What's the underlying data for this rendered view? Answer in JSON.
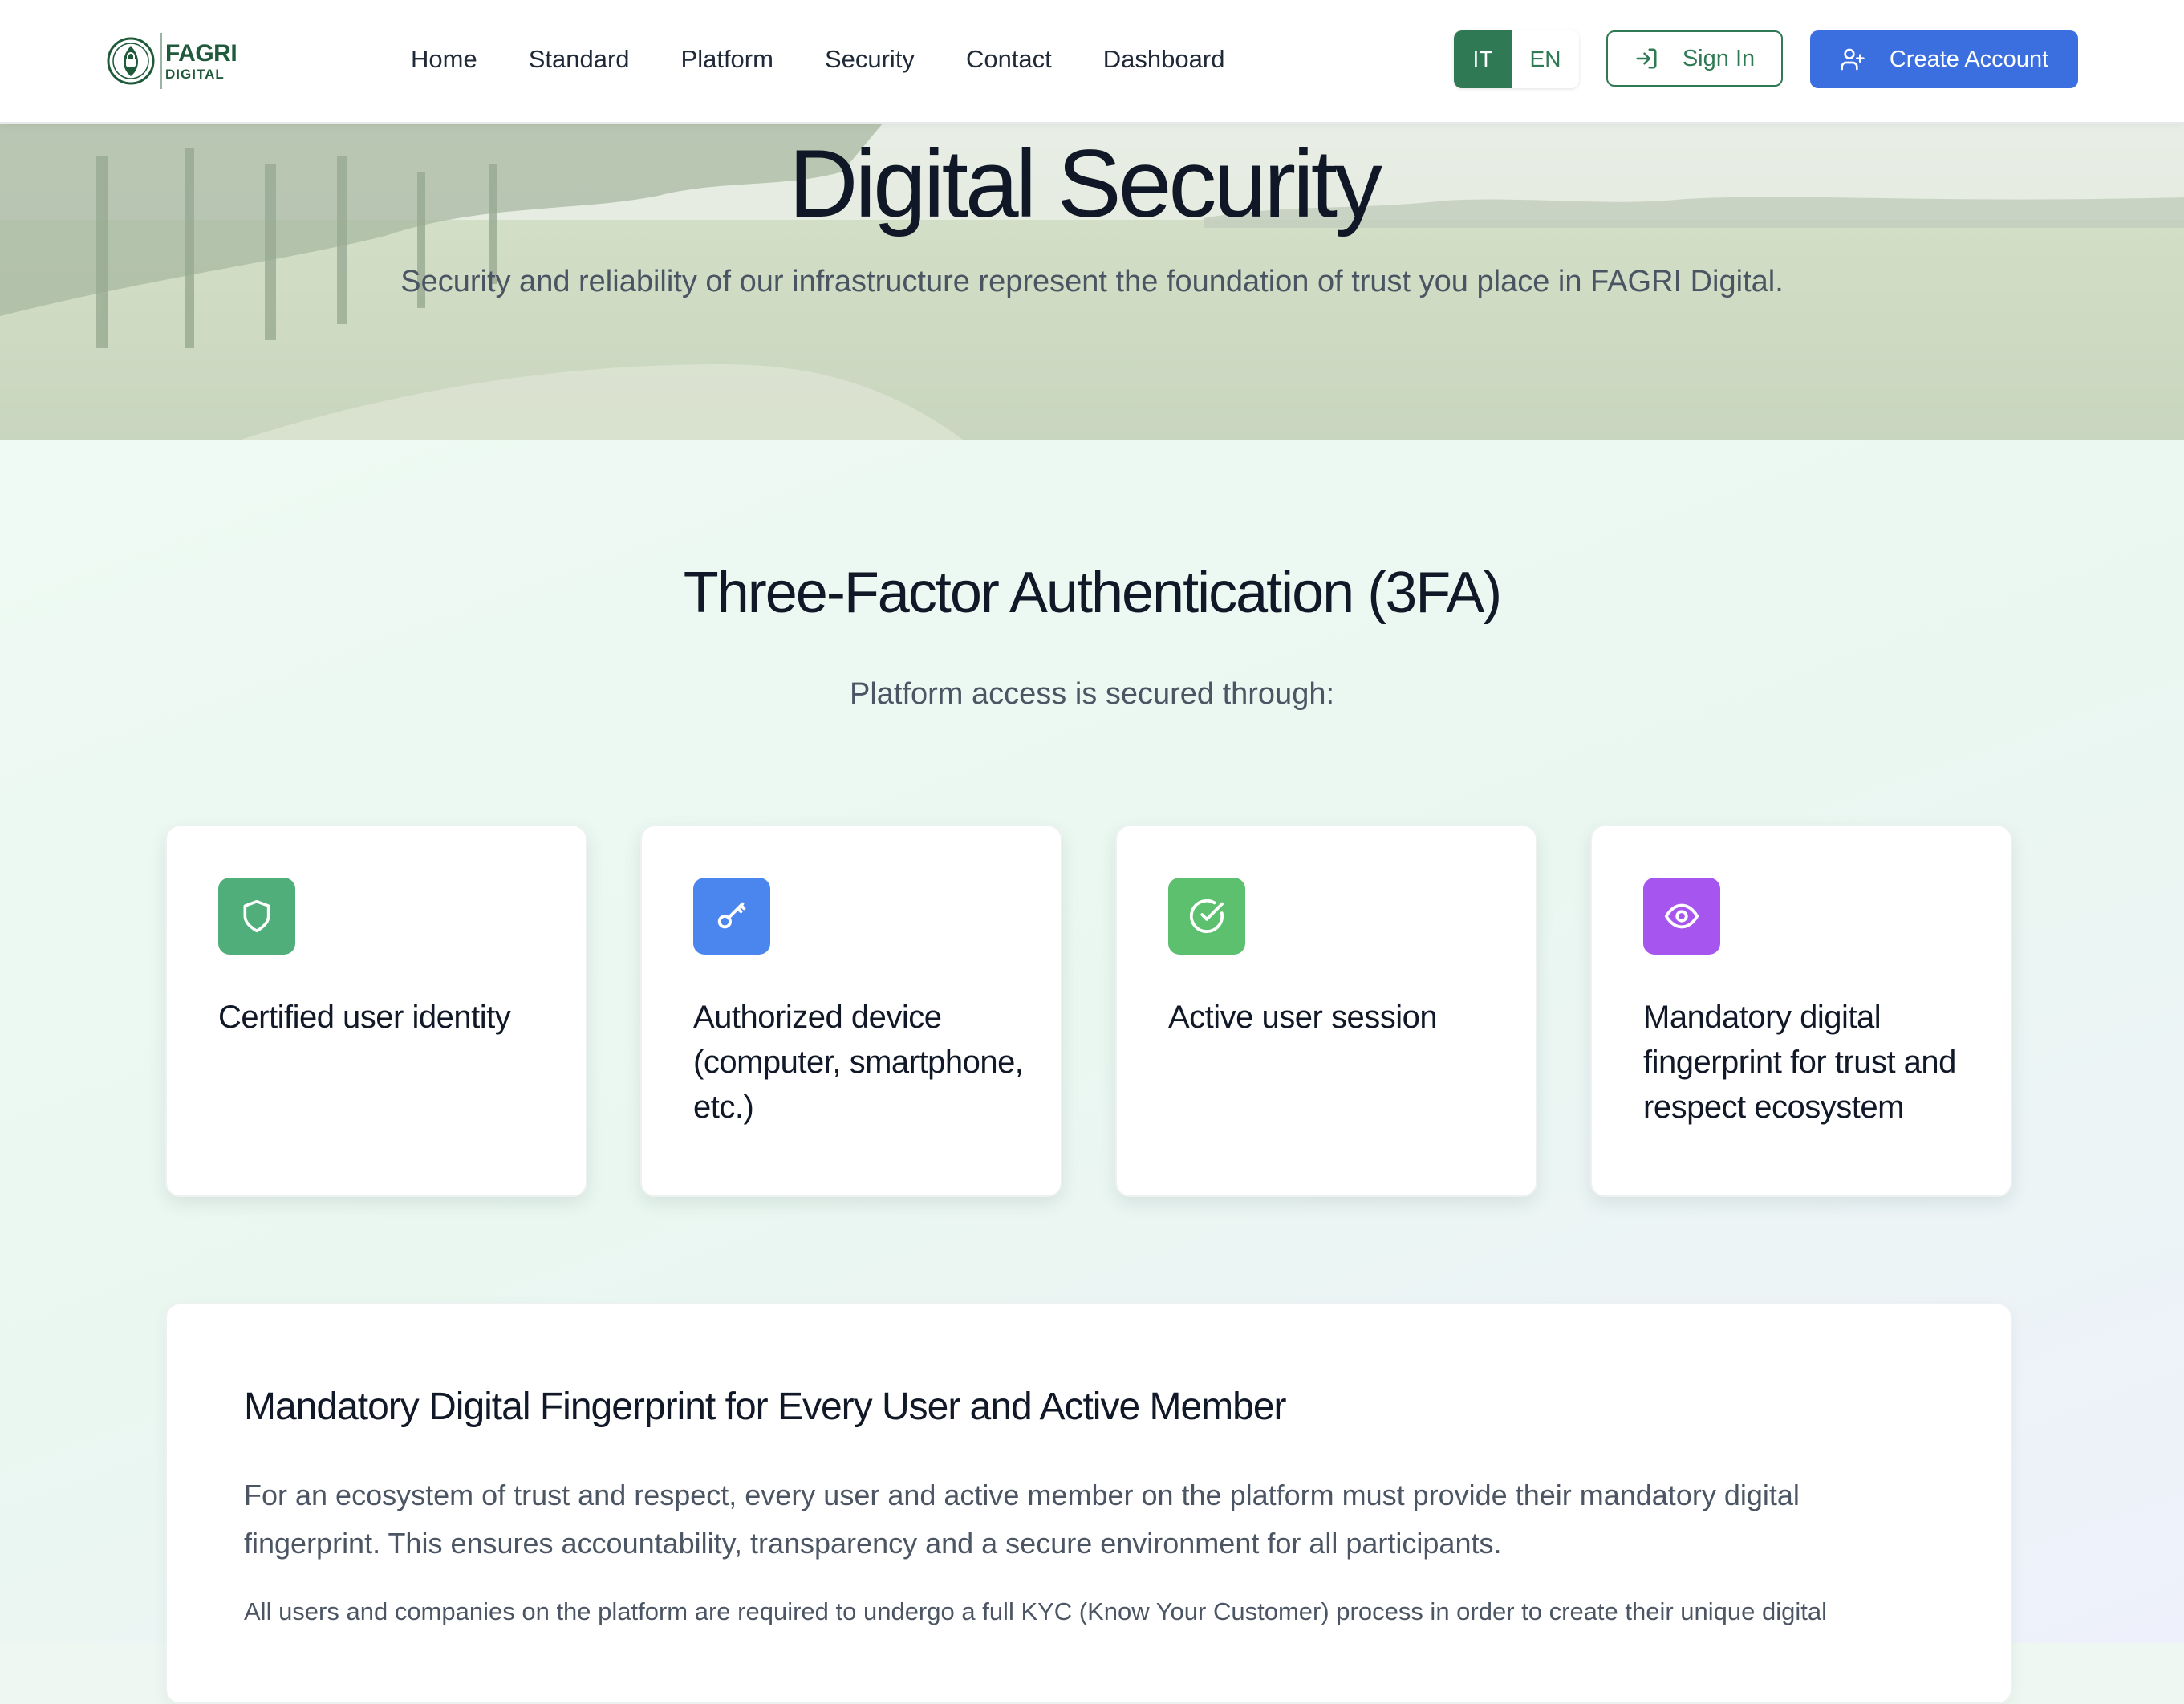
{
  "brand": {
    "line1": "FAGRI",
    "line2": "DIGITAL"
  },
  "nav": {
    "items": [
      {
        "label": "Home"
      },
      {
        "label": "Standard"
      },
      {
        "label": "Platform"
      },
      {
        "label": "Security"
      },
      {
        "label": "Contact"
      },
      {
        "label": "Dashboard"
      }
    ]
  },
  "language": {
    "options": [
      "IT",
      "EN"
    ],
    "selected": "IT"
  },
  "auth": {
    "sign_in": "Sign In",
    "create_account": "Create Account"
  },
  "hero": {
    "title": "Digital Security",
    "subtitle": "Security and reliability of our infrastructure represent the foundation of trust you place in FAGRI Digital."
  },
  "section": {
    "title": "Three-Factor Authentication (3FA)",
    "subtitle": "Platform access is secured through:"
  },
  "cards": [
    {
      "label": "Certified user identity",
      "icon": "shield-icon",
      "color": "#4fae79"
    },
    {
      "label": "Authorized device (computer, smartphone, etc.)",
      "icon": "key-icon",
      "color": "#4b86ee"
    },
    {
      "label": "Active user session",
      "icon": "check-circle-icon",
      "color": "#5cc06e"
    },
    {
      "label": "Mandatory digital fingerprint for trust and respect ecosystem",
      "icon": "eye-icon",
      "color": "#a655ee"
    }
  ],
  "panel": {
    "title": "Mandatory Digital Fingerprint for Every User and Active Member",
    "paragraph1": "For an ecosystem of trust and respect, every user and active member on the platform must provide their mandatory digital fingerprint. This ensures accountability, transparency and a secure environment for all participants.",
    "paragraph2": "All users and companies on the platform are required to undergo a full KYC (Know Your Customer) process in order to create their unique digital"
  },
  "colors": {
    "brand_green": "#2f7a55",
    "primary_blue": "#3b6fe0"
  }
}
